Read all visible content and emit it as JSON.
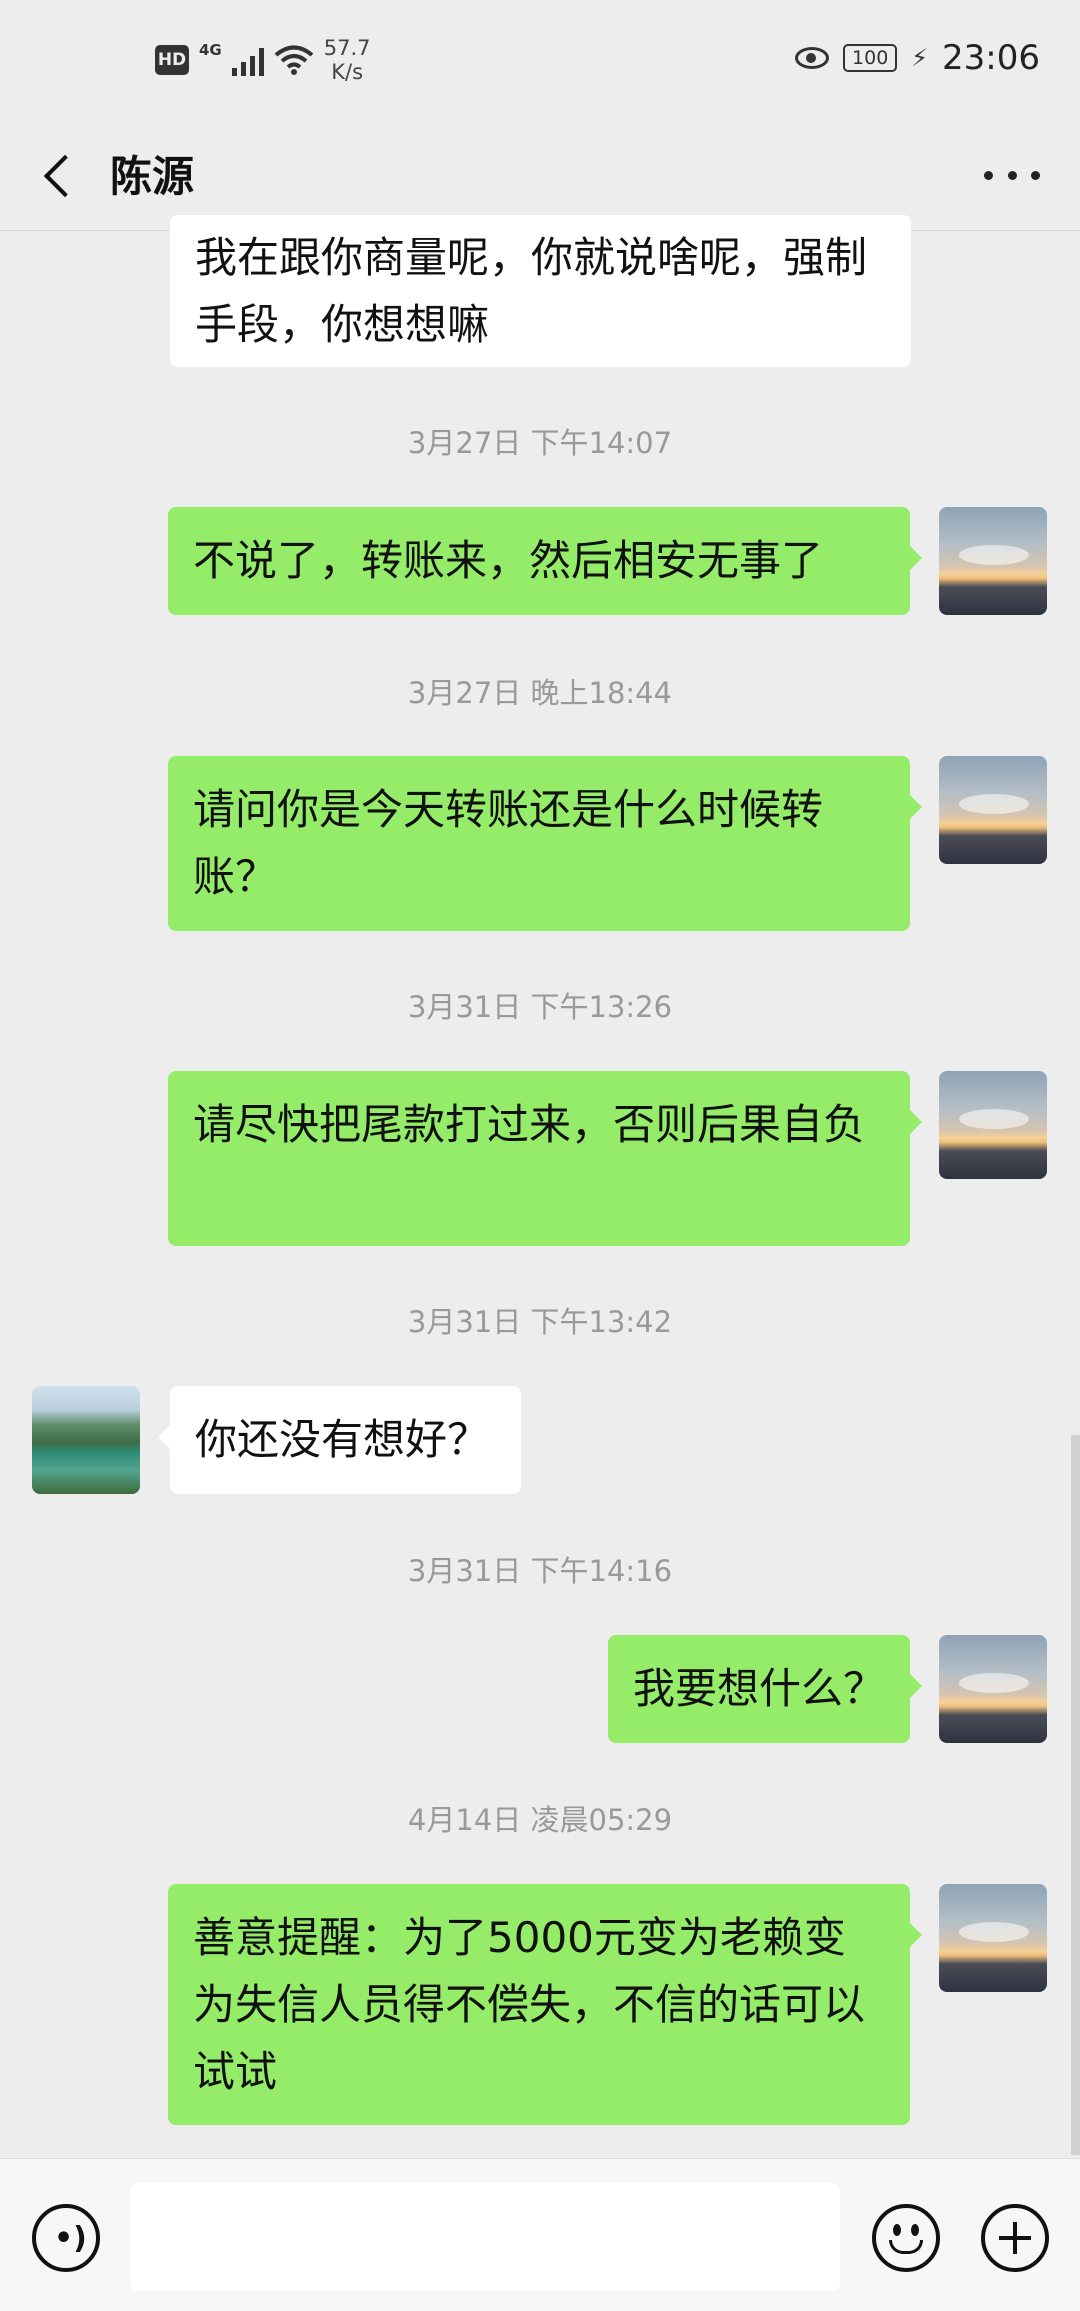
{
  "status_bar": {
    "hd_label": "HD",
    "network_label": "4G",
    "speed_value": "57.7",
    "speed_unit": "K/s",
    "battery": "100",
    "time": "23:06"
  },
  "header": {
    "title": "陈源",
    "back_icon": "chevron-left-icon",
    "more_icon": "more-dots-icon"
  },
  "messages": [
    {
      "type": "in",
      "text": "我在跟你商量呢，你就说啥呢，强制手段，你想想嘛"
    },
    {
      "type": "time",
      "text": "3月27日 下午14:07"
    },
    {
      "type": "out",
      "text": "不说了，转账来，然后相安无事了"
    },
    {
      "type": "time",
      "text": "3月27日 晚上18:44"
    },
    {
      "type": "out",
      "text": "请问你是今天转账还是什么时候转账？"
    },
    {
      "type": "time",
      "text": "3月31日 下午13:26"
    },
    {
      "type": "out",
      "text": "请尽快把尾款打过来，否则后果自负"
    },
    {
      "type": "time",
      "text": "3月31日 下午13:42"
    },
    {
      "type": "in",
      "text": "你还没有想好？"
    },
    {
      "type": "time",
      "text": "3月31日 下午14:16"
    },
    {
      "type": "out",
      "text": "我要想什么？"
    },
    {
      "type": "time",
      "text": "4月14日 凌晨05:29"
    },
    {
      "type": "out",
      "text": "善意提醒：为了5000元变为老赖变为失信人员得不偿失，不信的话可以试试"
    }
  ],
  "input_bar": {
    "voice_icon": "voice-icon",
    "emoji_icon": "emoji-icon",
    "plus_icon": "plus-icon",
    "input_value": ""
  },
  "colors": {
    "background": "#ededed",
    "sent_bubble": "#95ec69",
    "received_bubble": "#ffffff",
    "timestamp": "#999999"
  }
}
